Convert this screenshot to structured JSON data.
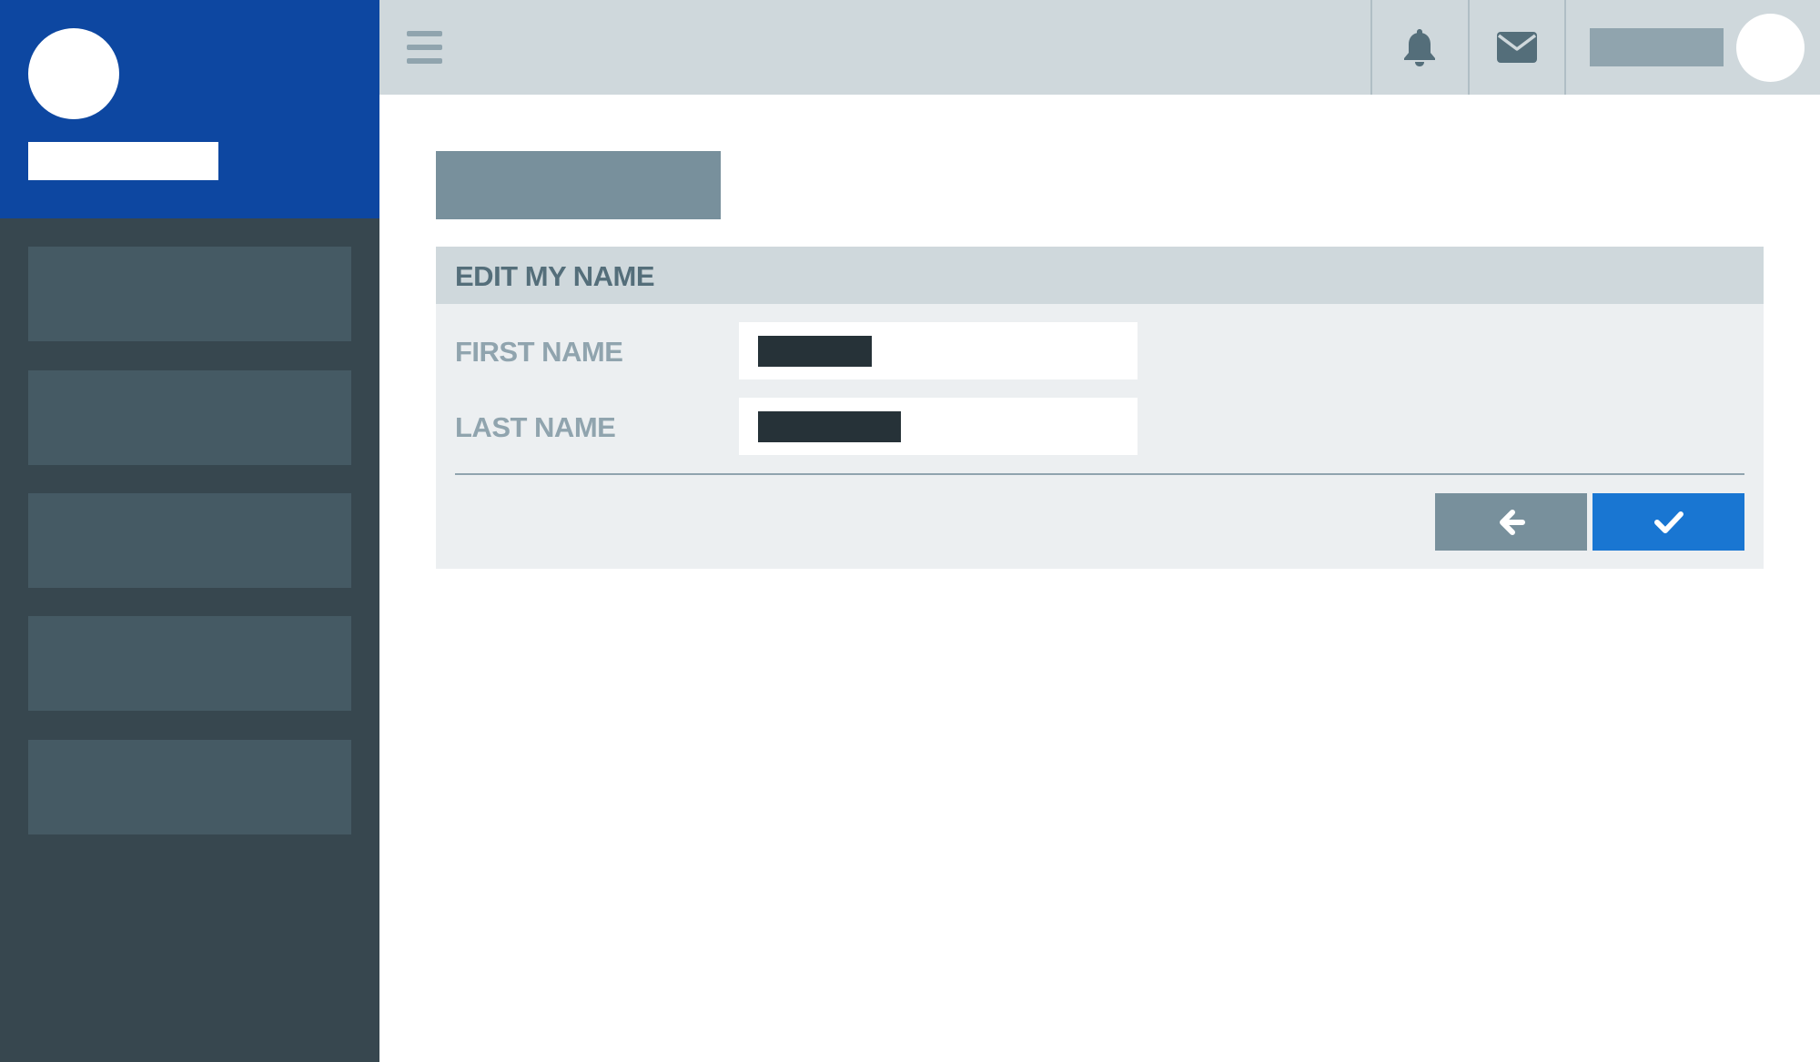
{
  "form": {
    "title": "EDIT MY NAME",
    "first_name_label": "FIRST NAME",
    "last_name_label": "LAST NAME"
  },
  "icons": {
    "menu": "hamburger-menu-icon",
    "notifications": "bell-icon",
    "messages": "envelope-icon",
    "back": "arrow-left-icon",
    "confirm": "checkmark-icon"
  },
  "colors": {
    "brand": "#0d47a1",
    "sidebar": "#37474f",
    "sidebar_item": "#455a64",
    "topbar": "#cfd8dc",
    "panel": "#eceff1",
    "confirm_button": "#1976d2",
    "back_button": "#78909c"
  }
}
